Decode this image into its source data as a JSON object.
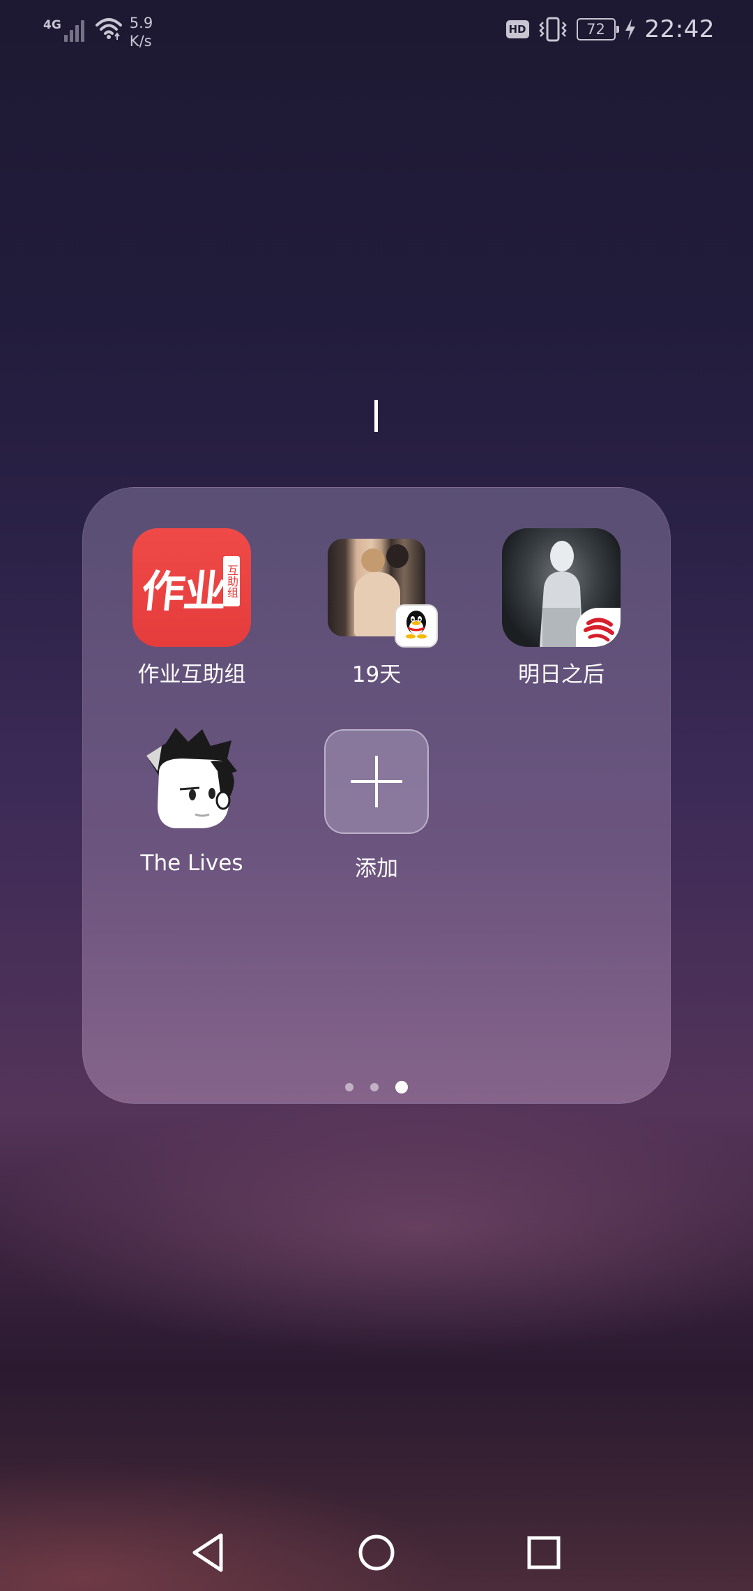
{
  "status_bar": {
    "network_type": "4G",
    "speed_value": "5.9",
    "speed_unit": "K/s",
    "hd_label": "HD",
    "battery_level": "72",
    "time": "22:42"
  },
  "folder": {
    "apps": [
      {
        "label": "作业互助组",
        "icon": "zuoye-app-icon",
        "icon_text": "作业",
        "icon_tag": "互助组"
      },
      {
        "label": "19天",
        "icon": "comic-19days-app-icon",
        "badge": "qq-penguin-icon"
      },
      {
        "label": "明日之后",
        "icon": "mingri-zhihou-app-icon",
        "badge": "netease-icon"
      },
      {
        "label": "The Lives",
        "icon": "cartoon-face-app-icon"
      },
      {
        "label": "添加",
        "icon": "plus-icon"
      }
    ],
    "pager": {
      "pages": 3,
      "current": 3
    }
  },
  "navigation": {
    "buttons": [
      "back-icon",
      "home-icon",
      "recents-icon"
    ]
  },
  "colors": {
    "accent_red": "#e53c3c",
    "text": "#ffffff",
    "status_text": "#c9c6d2"
  }
}
